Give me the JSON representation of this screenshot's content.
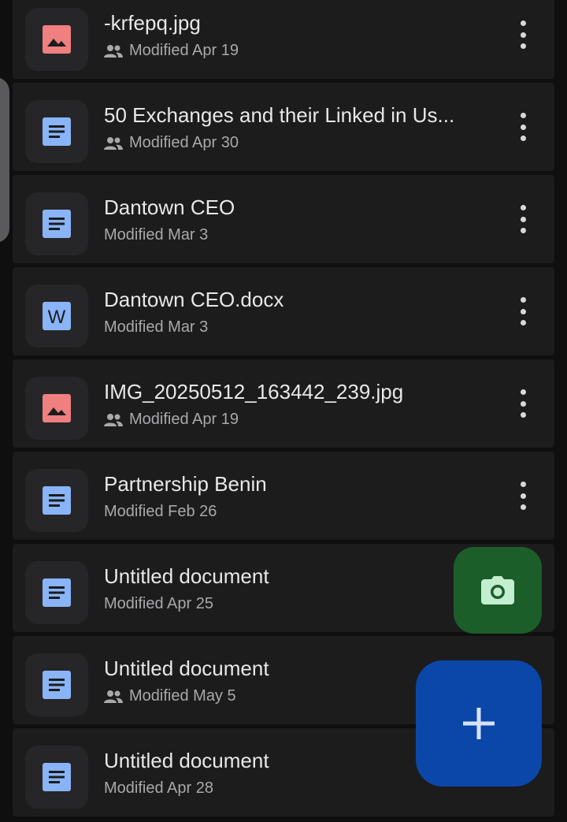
{
  "files": [
    {
      "name": "-krfepq.jpg",
      "modified": "Modified Apr 19",
      "type": "image-icon",
      "shared": true
    },
    {
      "name": "50 Exchanges and their Linked in Us...",
      "modified": "Modified Apr 30",
      "type": "doc-icon",
      "shared": true
    },
    {
      "name": "Dantown CEO",
      "modified": "Modified Mar 3",
      "type": "doc-icon",
      "shared": false
    },
    {
      "name": "Dantown CEO.docx",
      "modified": "Modified Mar 3",
      "type": "word-icon",
      "shared": false
    },
    {
      "name": "IMG_20250512_163442_239.jpg",
      "modified": "Modified Apr 19",
      "type": "image-icon",
      "shared": true
    },
    {
      "name": "Partnership Benin",
      "modified": "Modified Feb 26",
      "type": "doc-icon",
      "shared": false
    },
    {
      "name": "Untitled document",
      "modified": "Modified Apr 25",
      "type": "doc-icon",
      "shared": false
    },
    {
      "name": "Untitled document",
      "modified": "Modified May 5",
      "type": "doc-icon",
      "shared": true
    },
    {
      "name": "Untitled document",
      "modified": "Modified Apr 28",
      "type": "doc-icon",
      "shared": false
    }
  ],
  "word_letter": "W",
  "colors": {
    "background": "#0f0f10",
    "row": "#1c1c1d",
    "doc": "#8ab4f8",
    "image": "#f07f7f",
    "fab_camera": "#1b5e2a",
    "fab_add": "#0b47a8"
  },
  "fab": {
    "camera_icon": "camera-icon",
    "add_icon": "plus-icon"
  }
}
